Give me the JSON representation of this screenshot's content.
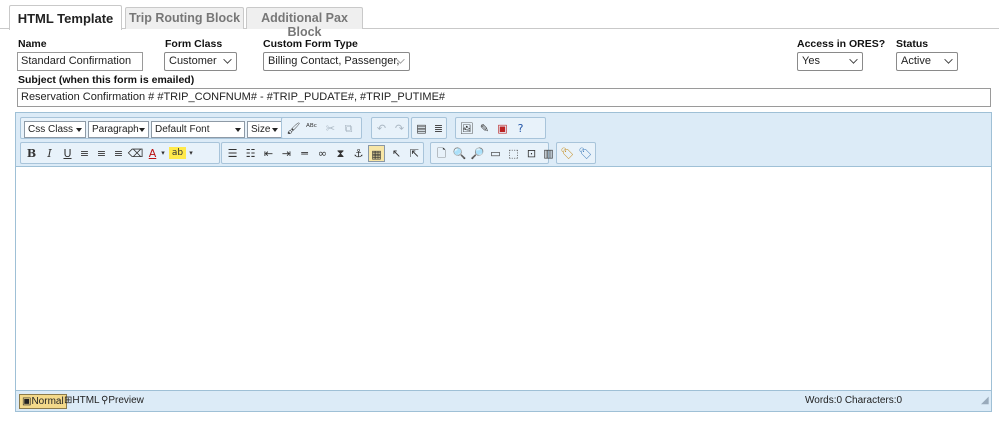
{
  "tabs": [
    {
      "label": "HTML Template",
      "active": true
    },
    {
      "label": "Trip Routing Block",
      "active": false
    },
    {
      "label": "Additional Pax Block",
      "active": false
    }
  ],
  "form": {
    "name_label": "Name",
    "name_value": "Standard Confirmation",
    "form_class_label": "Form Class",
    "form_class_value": "Customer",
    "custom_form_type_label": "Custom Form Type",
    "custom_form_type_value": "Billing Contact, Passenger,",
    "access_label": "Access in ORES?",
    "access_value": "Yes",
    "status_label": "Status",
    "status_value": "Active",
    "subject_label": "Subject (when this form is emailed)",
    "subject_value": "Reservation Confirmation # #TRIP_CONFNUM# - #TRIP_PUDATE#,  #TRIP_PUTIME#"
  },
  "editor": {
    "css_class": "Css Class",
    "paragraph": "Paragraph",
    "font": "Default Font",
    "size": "Size",
    "modes": [
      "Normal",
      "HTML",
      "Preview"
    ],
    "word_count": "Words:0 Characters:0"
  },
  "colors": {
    "toolbar_bg": "#dcebf7",
    "border": "#9fc0d6",
    "active_mode": "#f3d98a"
  }
}
